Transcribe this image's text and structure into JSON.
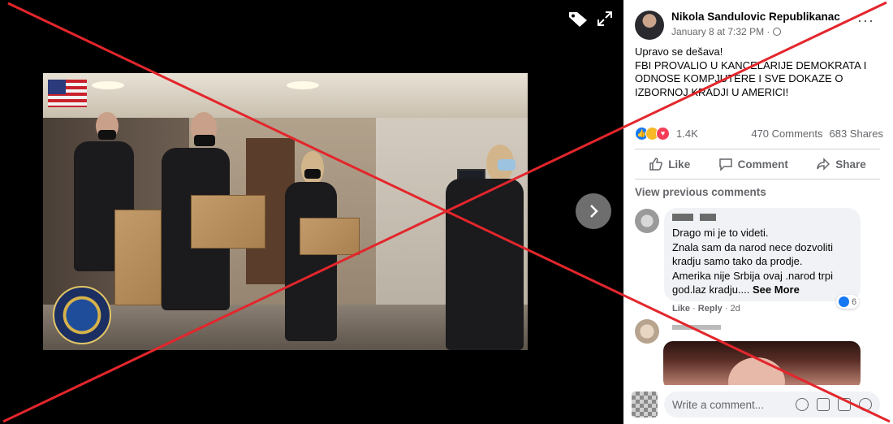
{
  "viewer": {
    "icons": [
      "tag-icon",
      "expand-icon",
      "chevron-right-icon"
    ]
  },
  "post": {
    "author": "Nikola Sandulovic Republikanac",
    "time": "January 8 at 7:32 PM · ",
    "more": "···",
    "text_lines": [
      "Upravo se dešava!",
      "FBI PROVALIO U KANCELARIJE DEMOKRATA I",
      "ODNOSE KOMPJUTERE I SVE DOKAZE O",
      "IZBORNOJ KRADJI U AMERICI!"
    ],
    "reactions_count": "1.4K",
    "comments_count": "470 Comments",
    "shares_count": "683 Shares"
  },
  "actions": {
    "like": "Like",
    "comment": "Comment",
    "share": "Share"
  },
  "comments": {
    "view_previous": "View previous comments",
    "first": {
      "lines": [
        "Drago mi je to videti.",
        "Znala sam da narod nece dozvoliti",
        "kradju samo tako da prodje.",
        "Amerika nije Srbija ovaj .narod trpi"
      ],
      "last_line": "god.laz kradju.... ",
      "see_more": "See More",
      "reaction_count": "6",
      "meta_like": "Like",
      "meta_reply": "Reply",
      "meta_time": "2d"
    }
  },
  "composer": {
    "placeholder": "Write a comment..."
  },
  "colors": {
    "facebook_blue": "#1877f2",
    "overlay_red": "#e3262c",
    "secondary_text": "#65676b"
  }
}
